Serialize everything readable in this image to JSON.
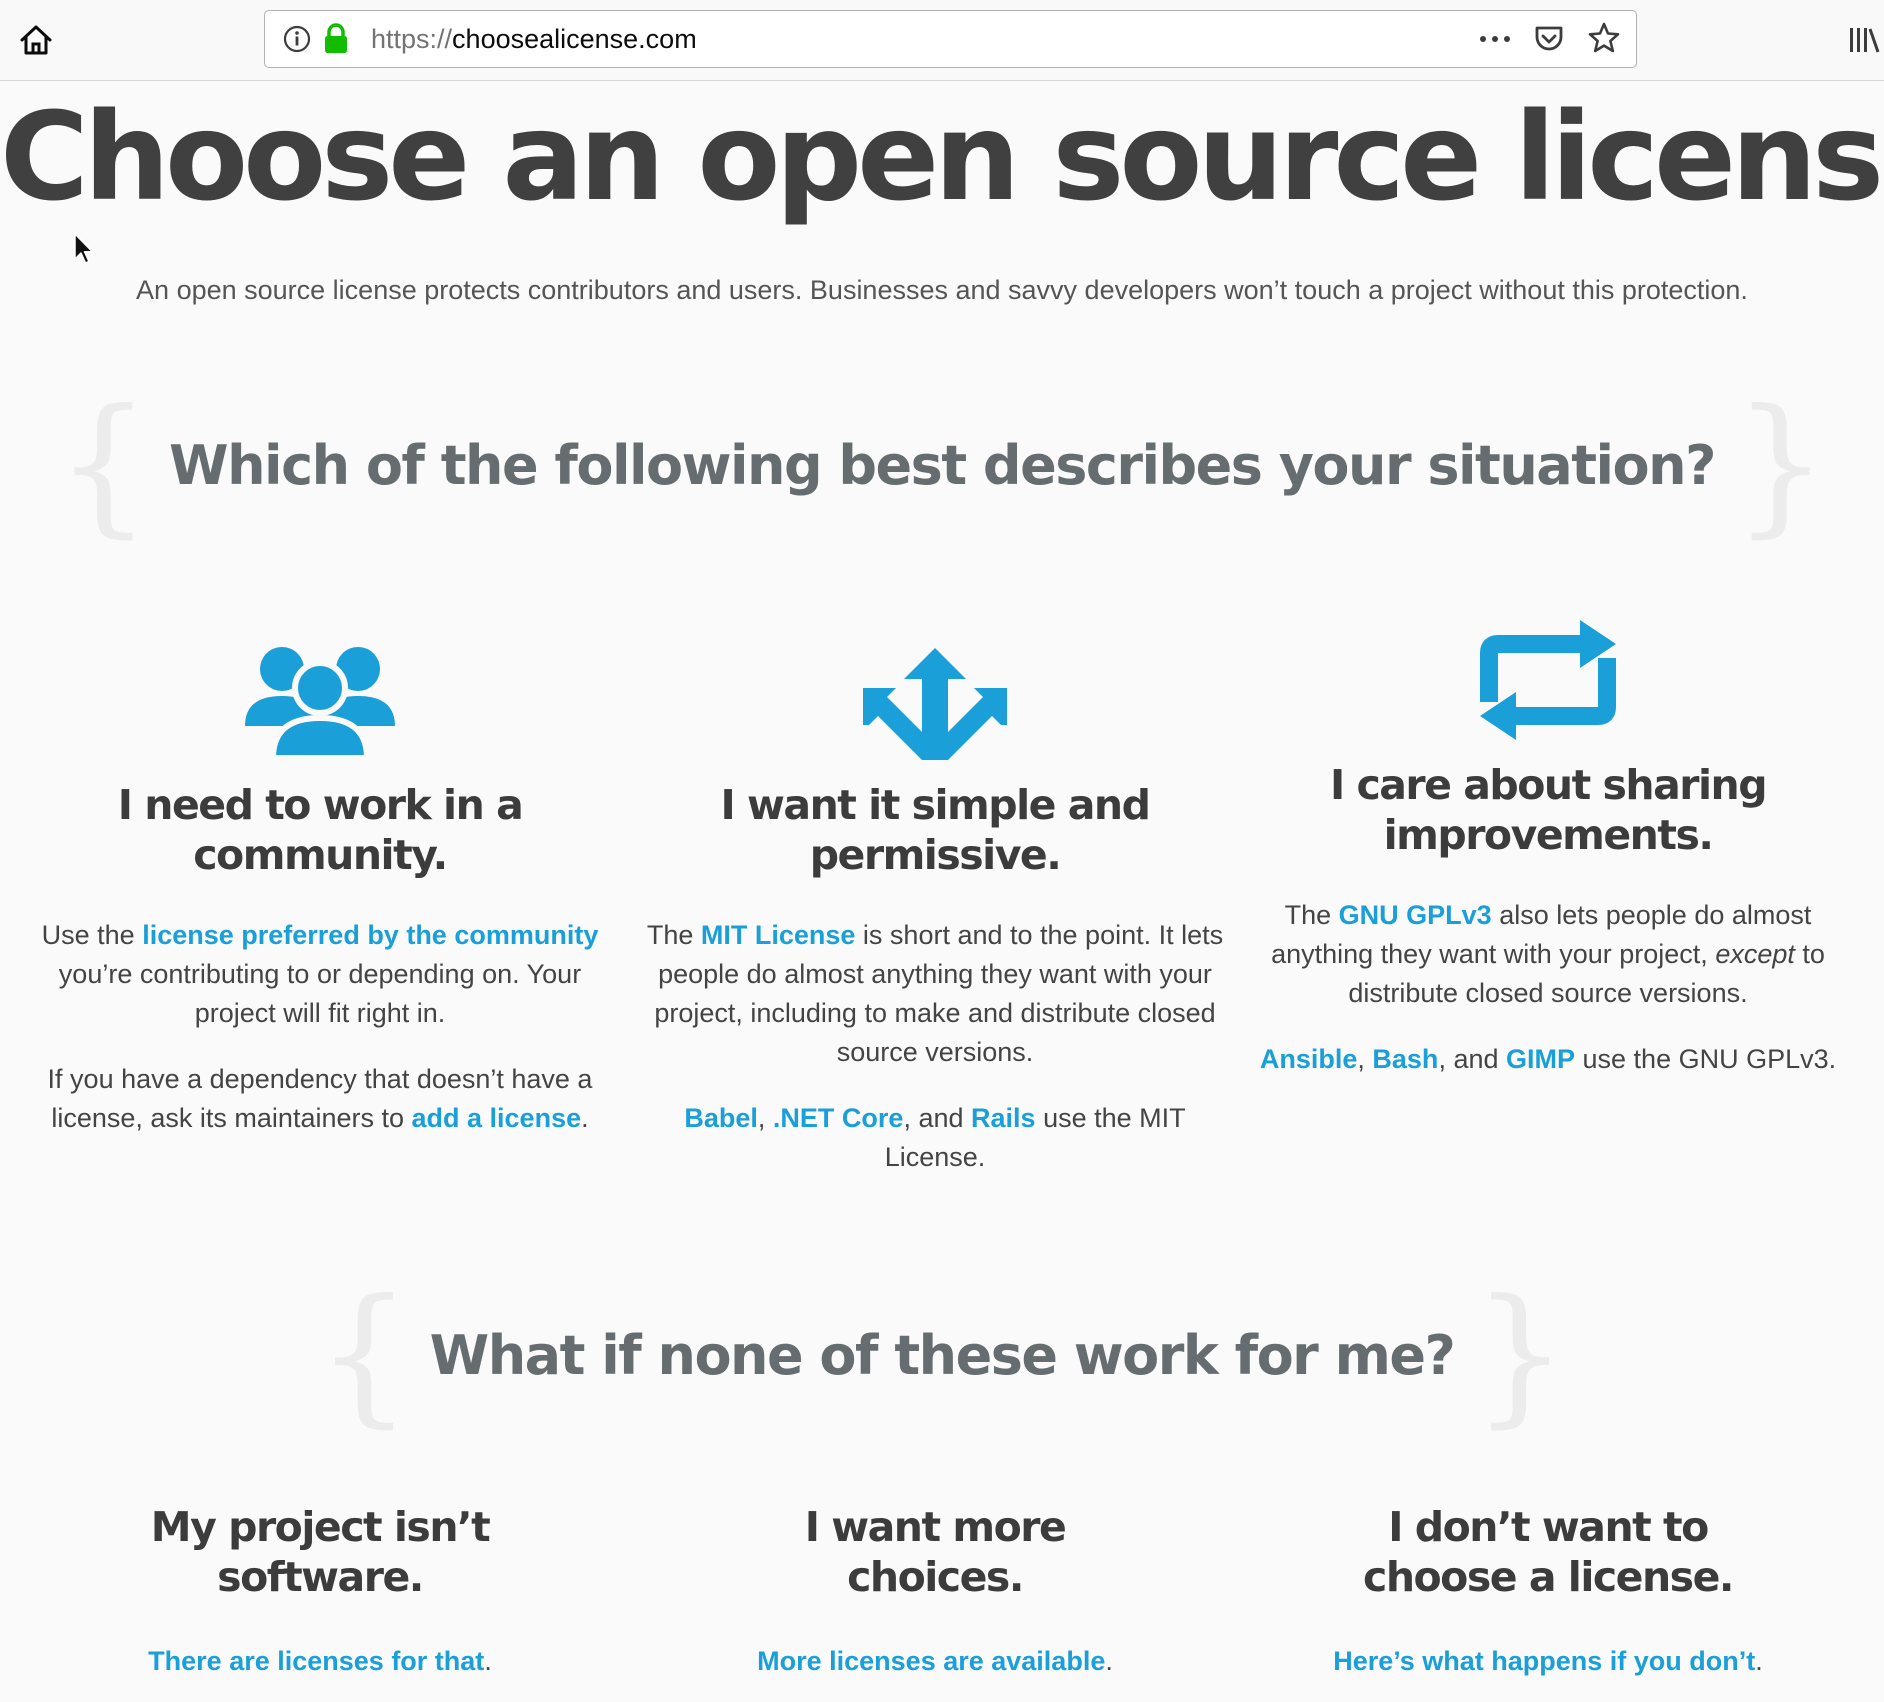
{
  "browser": {
    "url_scheme": "https://",
    "url_host": "choosealicense.com"
  },
  "hero": {
    "title": "Choose an open source license",
    "tagline": "An open source license protects contributors and users. Businesses and savvy developers won’t touch a project without this protection."
  },
  "situation": {
    "heading": "Which of the following best describes your situation?",
    "open_brace": "{",
    "close_brace": "}",
    "columns": [
      {
        "icon": "community-people-icon",
        "title_line1": "I need to work in a",
        "title_line2": "community.",
        "p1_pre": "Use the ",
        "p1_link": "license preferred by the community",
        "p1_post": " you’re contributing to or depending on. Your project will fit right in.",
        "p2_pre": "If you have a dependency that doesn’t have a license, ask its maintainers to ",
        "p2_link": "add a license",
        "p2_post": "."
      },
      {
        "icon": "arrows-spread-icon",
        "title_line1": "I want it simple and",
        "title_line2": "permissive.",
        "p1_pre": "The ",
        "p1_link": "MIT License",
        "p1_post": " is short and to the point. It lets people do almost anything they want with your project, including to make and distribute closed source versions.",
        "p2_link1": "Babel",
        "p2_sep1": ", ",
        "p2_link2": ".NET Core",
        "p2_sep2": ", and ",
        "p2_link3": "Rails",
        "p2_post": " use the MIT License."
      },
      {
        "icon": "repeat-arrows-icon",
        "title_line1": "I care about sharing",
        "title_line2": "improvements.",
        "p1_pre": "The ",
        "p1_link": "GNU GPLv3",
        "p1_mid": " also lets people do almost anything they want with your project, ",
        "p1_em": "except",
        "p1_post": " to distribute closed source versions.",
        "p2_link1": "Ansible",
        "p2_sep1": ", ",
        "p2_link2": "Bash",
        "p2_sep2": ", and ",
        "p2_link3": "GIMP",
        "p2_post": " use the GNU GPLv3."
      }
    ]
  },
  "alternatives": {
    "heading": "What if none of these work for me?",
    "open_brace": "{",
    "close_brace": "}",
    "columns": [
      {
        "title_line1": "My project isn’t",
        "title_line2": "software.",
        "link": "There are licenses for that",
        "post": "."
      },
      {
        "title_line1": "I want more",
        "title_line2": "choices.",
        "link": "More licenses are available",
        "post": "."
      },
      {
        "title_line1": "I don’t want to",
        "title_line2": "choose a license.",
        "link": "Here’s what happens if you don’t",
        "post": "."
      }
    ]
  },
  "colors": {
    "link": "#1a9fd8",
    "icon": "#1a9fd8",
    "heading": "#404040",
    "section_heading": "#666d70",
    "brace": "#ececec"
  }
}
